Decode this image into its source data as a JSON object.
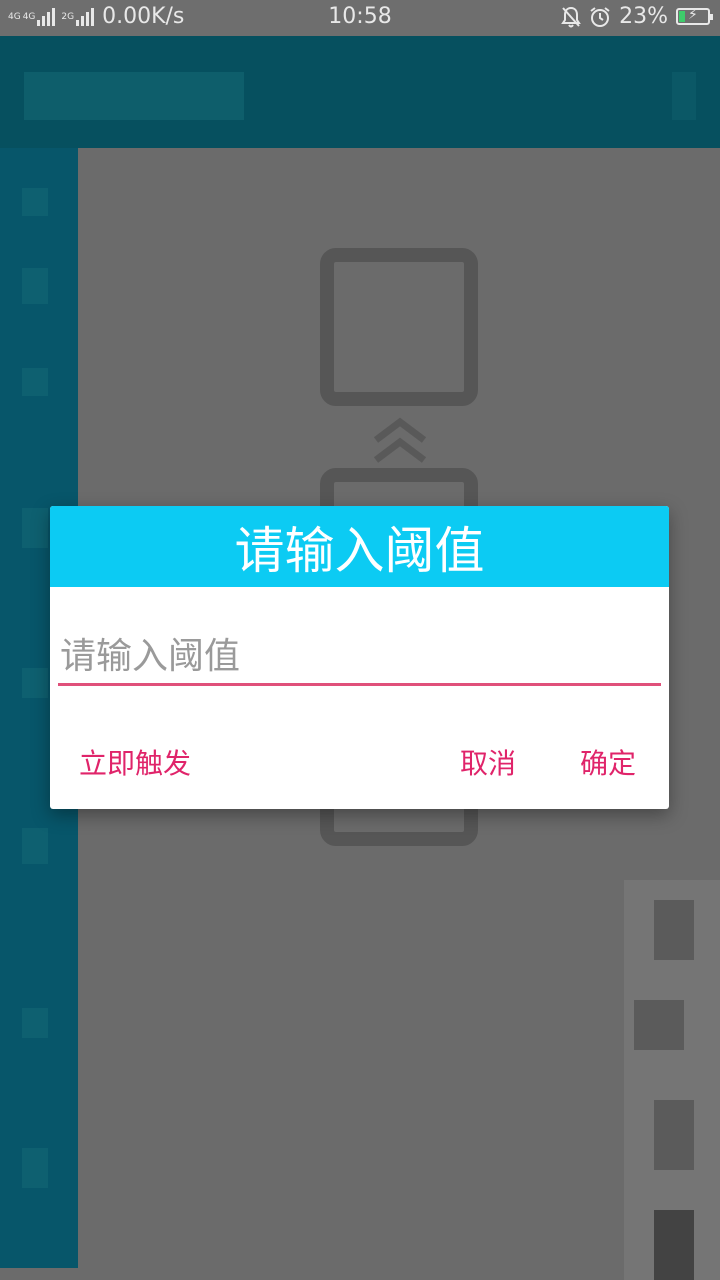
{
  "status_bar": {
    "network_left": "4G",
    "network_mid": "4G",
    "network_right": "2G",
    "speed": "0.00K/s",
    "time": "10:58",
    "mute_icon": "bell-off-icon",
    "alarm_icon": "alarm-clock-icon",
    "battery_percent": "23%",
    "battery_level": 0.23,
    "battery_color": "#3ecb6b"
  },
  "dialog": {
    "title": "请输入阈值",
    "input": {
      "value": "",
      "placeholder": "请输入阈值"
    },
    "buttons": {
      "trigger_now": "立即触发",
      "cancel": "取消",
      "confirm": "确定"
    },
    "colors": {
      "header": "#0ccbf3",
      "accent": "#e0246a"
    }
  }
}
